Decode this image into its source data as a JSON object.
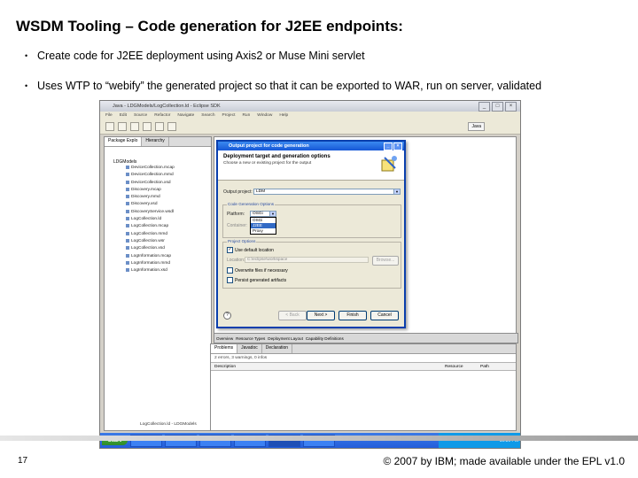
{
  "slide": {
    "title": "WSDM Tooling – Code generation for J2EE endpoints:",
    "bullets": [
      "Create code for J2EE deployment using Axis2 or Muse Mini servlet",
      "Uses WTP to “webify” the generated project so that it can be exported to WAR, run on server, validated"
    ],
    "page_number": "17",
    "copyright": "© 2007 by IBM; made available under the EPL v1.0"
  },
  "eclipse": {
    "window_title": "Java - LDGModels/LogCollection.ld - Eclipse SDK",
    "menus": [
      "File",
      "Edit",
      "Source",
      "Refactor",
      "Navigate",
      "Search",
      "Project",
      "Run",
      "Window",
      "Help"
    ],
    "perspective": "Java",
    "package_explorer": {
      "tabs": [
        "Package Explo",
        "Hierarchy"
      ],
      "root": "LDGModels",
      "items": [
        "DeviceCollection.mcap",
        "DeviceCollection.mmd",
        "DeviceCollection.xsd",
        "Discovery.mcap",
        "Discovery.mmd",
        "Discovery.xsd",
        "DiscoveryService.wsdl",
        "LogCollection.ld",
        "LogCollection.mcap",
        "LogCollection.mmd",
        "LogCollection.wsr",
        "LogCollection.xsd",
        "LogInformation.mcap",
        "LogInformation.mmd",
        "LogInformation.xsd"
      ],
      "status": "LogCollection.ld - LDGModels"
    },
    "bottom_tabs": [
      "Overview",
      "Resource Types",
      "Deployment Layout",
      "Capability Definitions"
    ],
    "problems": {
      "tabs": [
        "Problems",
        "Javadoc",
        "Declaration"
      ],
      "summary": "2 errors, 3 warnings, 0 infos",
      "columns": [
        "Description",
        "Resource",
        "Path"
      ]
    },
    "taskbar": {
      "start": "start",
      "items": [
        "In T...",
        "W...",
        "Com...",
        "Com...",
        "Java",
        "Mi..."
      ],
      "clock": "10:30 PM"
    }
  },
  "dialog": {
    "title": "Output project for code generation",
    "header_title": "Deployment target and generation options",
    "header_subtitle": "Choose a new or existing project for the output",
    "output_project_label": "Output project:",
    "output_project_value": "LDM",
    "code_options_label": "Code Generation Options",
    "platform_label": "Platform:",
    "platform_value": "OSGi",
    "container_label": "Container:",
    "platform_options": [
      "OSGi",
      "J2EE",
      "Proxy"
    ],
    "platform_highlighted": "J2EE",
    "project_options_label": "Project Options",
    "use_default_location": "Use default location",
    "location_label": "Location:",
    "location_value": "C:\\eclipse\\workspace",
    "browse_label": "Browse...",
    "overwrite_label": "Overwrite files if necessary",
    "persist_label": "Persist generated artifacts",
    "buttons": {
      "back": "< Back",
      "next": "Next >",
      "finish": "Finish",
      "cancel": "Cancel"
    }
  }
}
